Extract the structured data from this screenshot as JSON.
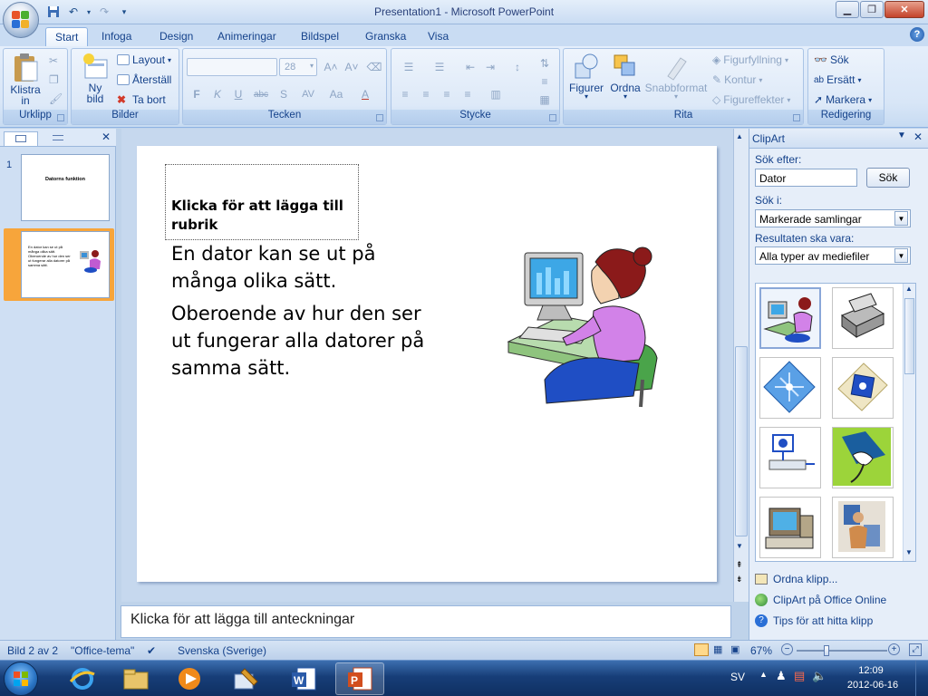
{
  "window": {
    "title": "Presentation1 - Microsoft PowerPoint"
  },
  "tabs": [
    {
      "label": "Start",
      "active": true
    },
    {
      "label": "Infoga"
    },
    {
      "label": "Design"
    },
    {
      "label": "Animeringar"
    },
    {
      "label": "Bildspel"
    },
    {
      "label": "Granska"
    },
    {
      "label": "Visa"
    }
  ],
  "ribbon": {
    "clipboard": {
      "label": "Urklipp",
      "paste_line1": "Klistra",
      "paste_line2": "in"
    },
    "slides": {
      "label": "Bilder",
      "new_line1": "Ny",
      "new_line2": "bild",
      "layout": "Layout",
      "reset": "Återställ",
      "delete": "Ta bort"
    },
    "font": {
      "label": "Tecken",
      "font_name": "",
      "font_size": "28",
      "bold": "F",
      "italic": "K",
      "underline": "U",
      "strike": "abc",
      "shadow": "S",
      "spacing": "AV",
      "case": "Aa",
      "color": "A"
    },
    "paragraph": {
      "label": "Stycke"
    },
    "drawing": {
      "label": "Rita",
      "shapes": "Figurer",
      "arrange": "Ordna",
      "quick_styles": "Snabbformat",
      "fill": "Figurfyllning",
      "outline": "Kontur",
      "effects": "Figureffekter"
    },
    "editing": {
      "label": "Redigering",
      "find": "Sök",
      "replace": "Ersätt",
      "select": "Markera"
    }
  },
  "slides_panel": {
    "thumbnails": [
      {
        "number": "1",
        "text": "Datorns funktion"
      },
      {
        "number": "2",
        "text": "En dator kan se ut på många olika sätt. Oberoende av hur den ser ut fungerar alla datorer på samma sätt."
      }
    ]
  },
  "slide": {
    "title_placeholder": "Klicka för att lägga till rubrik",
    "body": [
      "En dator kan se ut på många olika sätt.",
      "Oberoende av hur den ser ut fungerar alla datorer på samma sätt."
    ]
  },
  "notes": {
    "placeholder": "Klicka för att lägga till anteckningar"
  },
  "clipart": {
    "title": "ClipArt",
    "search_label": "Sök efter:",
    "search_value": "Dator",
    "search_button": "Sök",
    "search_in_label": "Sök i:",
    "search_in_value": "Markerade samlingar",
    "results_label": "Resultaten ska vara:",
    "results_value": "Alla typer av mediefiler",
    "links": [
      "Ordna klipp...",
      "ClipArt på Office Online",
      "Tips för att hitta klipp"
    ]
  },
  "status": {
    "slide": "Bild 2 av 2",
    "theme": "\"Office-tema\"",
    "language": "Svenska (Sverige)",
    "zoom": "67%",
    "zoom_level": 0.67
  },
  "taskbar": {
    "lang": "SV",
    "time": "12:09",
    "date": "2012-06-16"
  },
  "colors": {
    "ribbon_bg": "#dbe7f7",
    "accent": "#15428b",
    "active_thumb": "#f7a53b",
    "taskbar": "#173e78"
  }
}
